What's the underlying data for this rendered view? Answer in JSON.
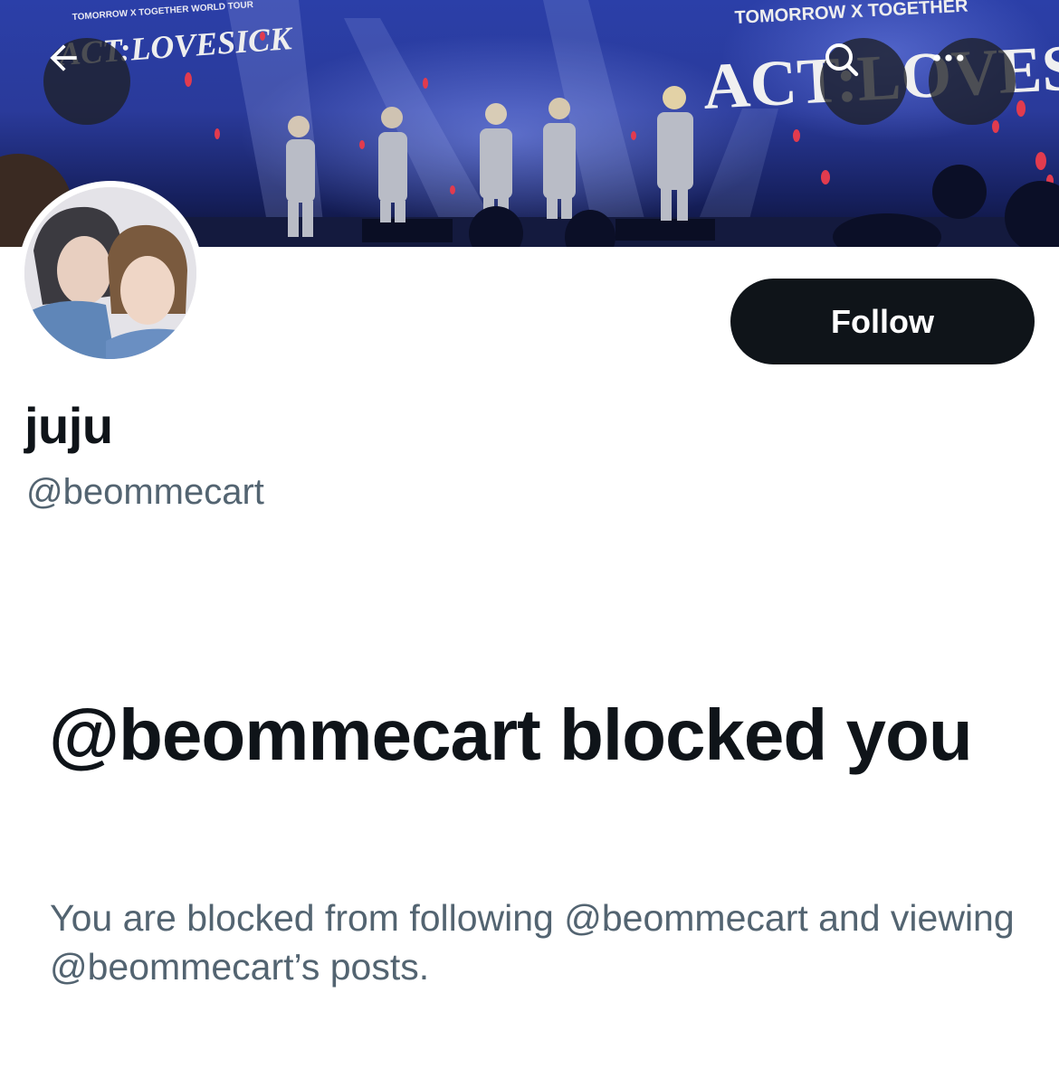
{
  "header": {
    "back_icon": "arrow-left-icon",
    "search_icon": "search-icon",
    "more_icon": "more-horizontal-icon",
    "banner_texts": {
      "left_tour": "TOMORROW X TOGETHER WORLD TOUR",
      "left_logo": "ACT:LOVESICK",
      "right_tour": "TOMORROW X TOGETHER",
      "right_logo": "ACT:LOVES"
    }
  },
  "profile": {
    "display_name": "juju",
    "handle": "@beommecart",
    "follow_label": "Follow"
  },
  "blocked": {
    "title": "@beommecart blocked you",
    "description": "You are blocked from following @beommecart and viewing @beommecart’s posts."
  },
  "colors": {
    "primary_text": "#0f1419",
    "secondary_text": "#536471",
    "follow_bg": "#0f1419",
    "follow_text": "#ffffff",
    "banner_blue": "#2b3fa8"
  }
}
